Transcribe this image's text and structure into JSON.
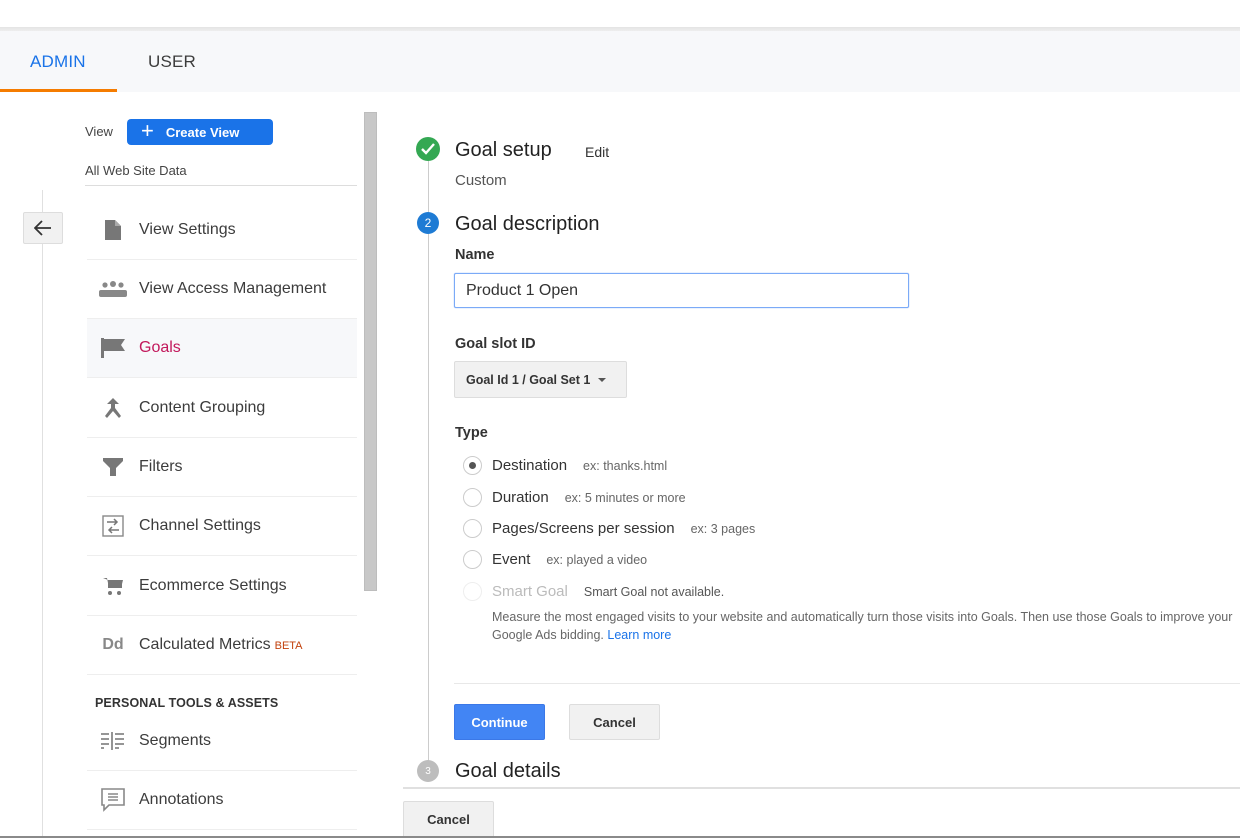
{
  "tabs": [
    {
      "label": "ADMIN",
      "active": true
    },
    {
      "label": "USER",
      "active": false
    }
  ],
  "accent_colors": {
    "primary": "#1a73e8",
    "tab_underline": "#f57c00",
    "active_nav": "#c2185b",
    "step_done": "#34a853",
    "step_current": "#1e7bd4"
  },
  "view": {
    "label": "View",
    "create_button": "Create View",
    "current_view": "All Web Site Data"
  },
  "sidebar": {
    "back_icon": "arrow-left-icon",
    "items": [
      {
        "label": "View Settings",
        "icon": "document-icon",
        "active": false
      },
      {
        "label": "View Access Management",
        "icon": "people-icon",
        "active": false
      },
      {
        "label": "Goals",
        "icon": "flag-icon",
        "active": true
      },
      {
        "label": "Content Grouping",
        "icon": "merge-icon",
        "active": false
      },
      {
        "label": "Filters",
        "icon": "filter-icon",
        "active": false
      },
      {
        "label": "Channel Settings",
        "icon": "channel-icon",
        "active": false
      },
      {
        "label": "Ecommerce Settings",
        "icon": "cart-icon",
        "active": false
      },
      {
        "label": "Calculated Metrics",
        "badge": "BETA",
        "icon": "dd-icon",
        "active": false
      }
    ],
    "section_heading": "PERSONAL TOOLS & ASSETS",
    "personal_items": [
      {
        "label": "Segments",
        "icon": "segments-icon"
      },
      {
        "label": "Annotations",
        "icon": "annotation-icon"
      }
    ]
  },
  "goal": {
    "step1": {
      "title": "Goal setup",
      "edit": "Edit",
      "value": "Custom"
    },
    "step2": {
      "number": "2",
      "title": "Goal description",
      "name_label": "Name",
      "name_value": "Product 1 Open",
      "slot_label": "Goal slot ID",
      "slot_value": "Goal Id 1 / Goal Set 1",
      "type_label": "Type",
      "types": [
        {
          "label": "Destination",
          "example": "ex: thanks.html",
          "checked": true,
          "disabled": false
        },
        {
          "label": "Duration",
          "example": "ex: 5 minutes or more",
          "checked": false,
          "disabled": false
        },
        {
          "label": "Pages/Screens per session",
          "example": "ex: 3 pages",
          "checked": false,
          "disabled": false
        },
        {
          "label": "Event",
          "example": "ex: played a video",
          "checked": false,
          "disabled": false
        },
        {
          "label": "Smart Goal",
          "example": "Smart Goal not available.",
          "checked": false,
          "disabled": true
        }
      ],
      "smart_description": "Measure the most engaged visits to your website and automatically turn those visits into Goals. Then use those Goals to improve your Google Ads bidding.",
      "learn_more": "Learn more",
      "continue": "Continue",
      "cancel": "Cancel"
    },
    "step3": {
      "number": "3",
      "title": "Goal details"
    },
    "footer_cancel": "Cancel"
  }
}
